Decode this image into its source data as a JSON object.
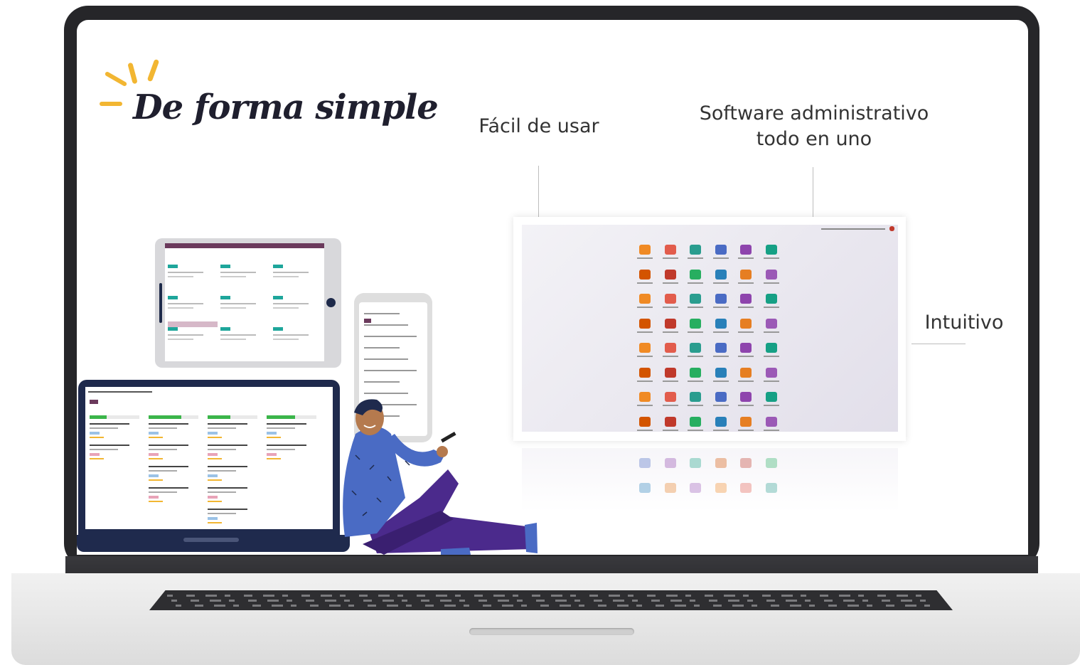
{
  "headline": "De forma simple",
  "features": {
    "easy": "Fácil de usar",
    "software_line1": "Software administrativo",
    "software_line2": "todo en uno",
    "intuitive": "Intuitivo"
  },
  "colors": {
    "accent_sun": "#f2b632",
    "navy": "#1f2a4d",
    "teal": "#1ea69b",
    "plum": "#6b3a5c",
    "person_shirt": "#4a6bc4",
    "person_pants": "#4b2a8c"
  },
  "icons": [
    "sun-rays-icon",
    "app-grid-icons",
    "person-illustration"
  ]
}
